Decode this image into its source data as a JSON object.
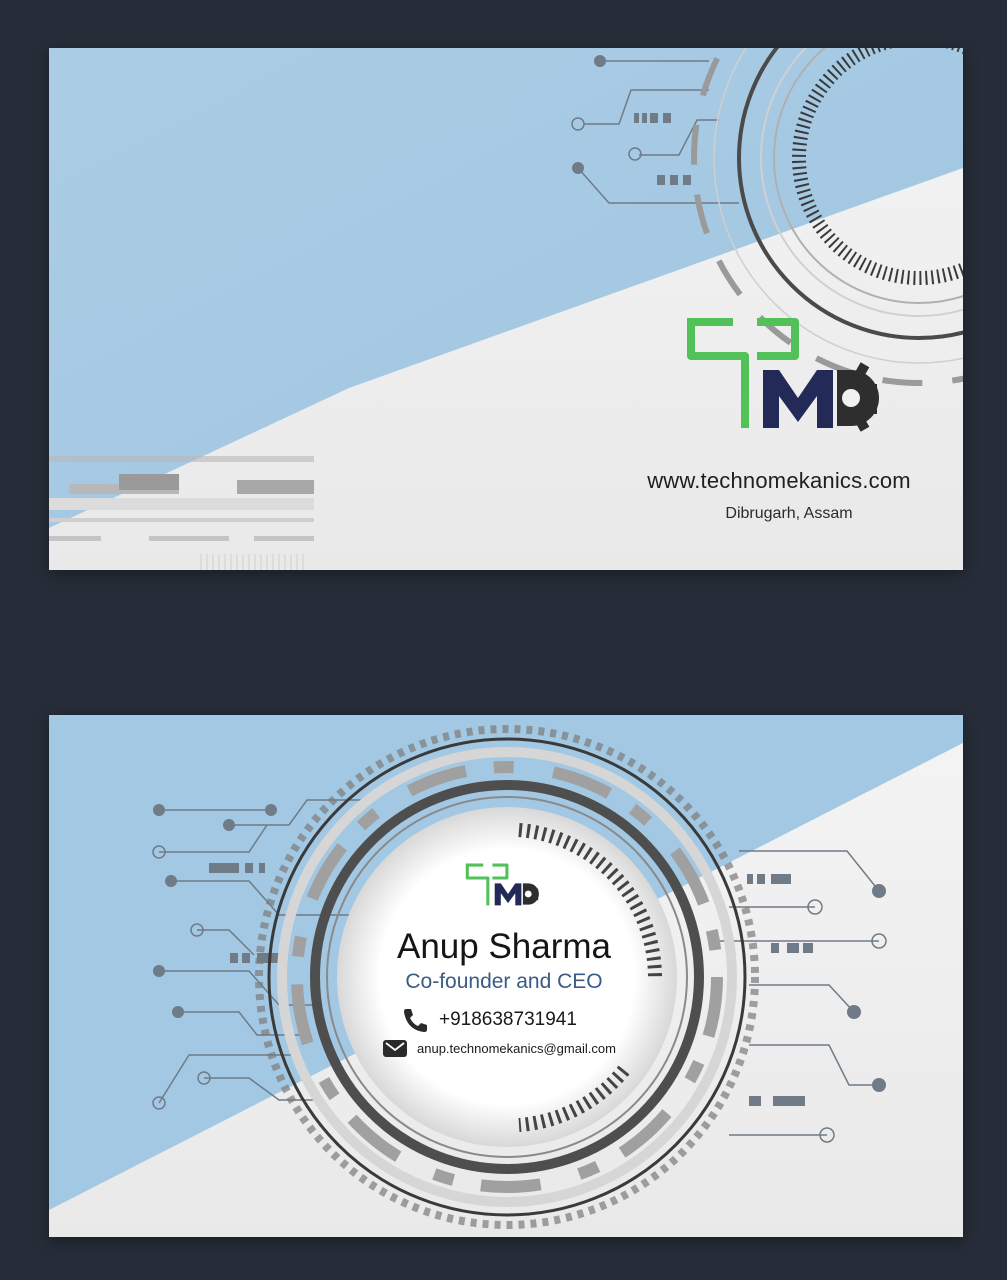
{
  "front": {
    "website": "www.technomekanics.com",
    "location": "Dibrugarh, Assam"
  },
  "back": {
    "name": "Anup Sharma",
    "title": "Co-founder and CEO",
    "phone": "+918638731941",
    "email": "anup.technomekanics@gmail.com"
  },
  "icons": [
    "logo-tm-gear-icon",
    "phone-icon",
    "mail-icon"
  ],
  "colors": {
    "page_background": "#262d38",
    "blue_panel": "#a3c8e3",
    "card": "#f1f1f1",
    "logo_green": "#52c158",
    "logo_navy": "#232a57",
    "logo_gear": "#2e2e2e",
    "title_blue": "#3a5b86"
  }
}
